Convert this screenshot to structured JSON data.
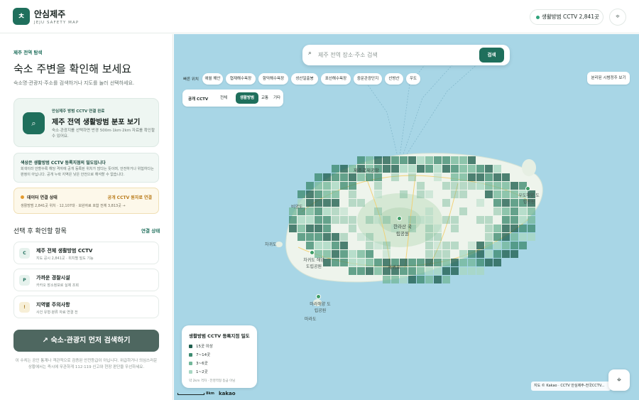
{
  "header": {
    "logo_char": "ㅊ",
    "title": "안심제주",
    "subtitle": "JEJU SAFETY MAP",
    "status_text": "생활방범 CCTV 2,841곳",
    "status_color": "#2fa37b",
    "locate_icon": "crosshair-icon"
  },
  "sidebar": {
    "eyebrow": "제주 전역 탐색",
    "title": "숙소 주변을 확인해 보세요",
    "description": "숙소명·관광지·주소를 검색하거나 지도를 눌러 선택하세요.",
    "main_card": {
      "icon": "search-icon",
      "eyebrow": "안심제주 방범 CCTV 연결 완료",
      "title": "제주 전역 생활방범 분포 보기",
      "description": "숙소·관광지를 선택하면 반경 500m·1km·2km 자료를 확인할 수 있어요."
    },
    "notice": {
      "title": "색상은 생활방범 CCTV 등록지점의 밀도입니다",
      "description": "회색이라 안할수록 해당 격자에 공개 등록된 위치가 많다는 뜻이며, 안전하거나 위험하다는 판정이 아닙니다. 공개 누락 지역은 낮은 안전으로 해석할 수 없습니다."
    },
    "connection": {
      "title": "데이터 연결 상태",
      "status": "공개 CCTV 원자료 연결",
      "description": "생활방범 2,841곳 위치 · 12,107대 · 보완자료 포함 전체 3,813곳 →"
    },
    "section_title": "선택 후 확인할 항목",
    "section_link": "연결 상태",
    "items": [
      {
        "badge": "C",
        "title": "제주 전체 생활방범 CCTV",
        "sub": "지도 공시 2,841곳 · 위치별 밀도 기능"
      },
      {
        "badge": "P",
        "title": "가까운 경찰시설",
        "sub": "카카오 장소정보로 실제 조회"
      },
      {
        "badge": "!",
        "title": "지역별 주의사항",
        "sub": "사건 유형·분류 자료 연결 전"
      }
    ],
    "cta": "↗  숙소·관광지 먼저 검색하기",
    "footnote": "이 수치는 공인 통계나 객관적으로 검증된 안전등급이 아닙니다. 위급하거나 의심스러운 상황에서는 즉시에 무관하게 112·119 신고와 현장 판단을 우선하세요."
  },
  "map": {
    "search": {
      "icon": "search-icon",
      "placeholder": "제주 전역 장소·주소 검색",
      "button": "검색"
    },
    "chips_label": "빠른 위치",
    "chips": [
      "애월 해안",
      "협재해수욕장",
      "함덕해수욕장",
      "성산일출봉",
      "표선해수욕장",
      "중문관광단지",
      "산방산",
      "우도"
    ],
    "shelter_button": "분리된 시범정주 보기",
    "segment": {
      "label": "공개 CCTV",
      "options": [
        "전체",
        "생활방범",
        "교통",
        "기타"
      ],
      "selected": "생활방범"
    },
    "legend": {
      "title": "생활방범 CCTV 등록지점 밀도",
      "rows": [
        {
          "label": "15곳 이상",
          "color": "#1f5f4e"
        },
        {
          "label": "7~14곳",
          "color": "#3d8b70"
        },
        {
          "label": "3~6곳",
          "color": "#73b79a"
        },
        {
          "label": "1~2곳",
          "color": "#a8d7c2"
        }
      ],
      "note": "약 2km 격자 · 전영역형 등급 아님"
    },
    "scale": "8km",
    "provider": "kakao",
    "attribution": "지도 © Kakao · CCTV 안심제주-전국CCTV...",
    "locate_icon": "crosshair-icon",
    "place_labels": [
      "제주국제공항",
      "한라산 국립공원",
      "마라해양 도립공원",
      "비양도",
      "차귀도",
      "우도해양 도립공원",
      "차귀도 해양도립공원",
      "서귀포",
      "마라도"
    ]
  }
}
